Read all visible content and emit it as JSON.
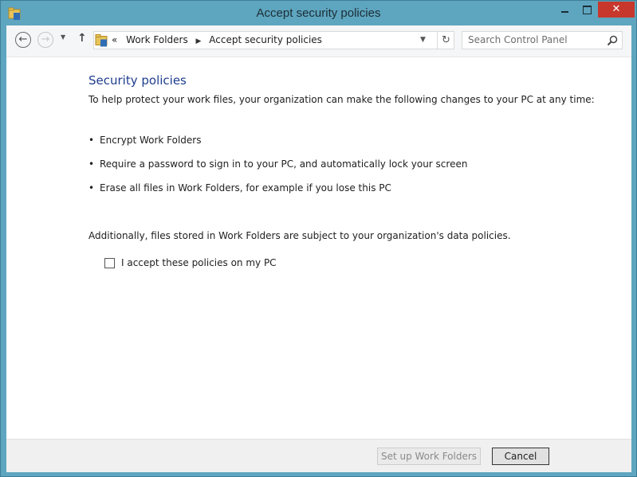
{
  "window": {
    "title": "Accept security policies"
  },
  "address": {
    "prefix": "«",
    "crumbs": [
      "Work Folders",
      "Accept security policies"
    ]
  },
  "search": {
    "placeholder": "Search Control Panel"
  },
  "content": {
    "heading": "Security policies",
    "intro": "To help protect your work files, your organization can make the following changes to your PC at any time:",
    "bullets": [
      "Encrypt Work Folders",
      "Require a password to sign in to your PC, and automatically lock your screen",
      "Erase all files in Work Folders, for example if you lose this PC"
    ],
    "additional": "Additionally, files stored in Work Folders are subject to your organization's data policies.",
    "accept_label": "I accept these policies on my PC",
    "accept_checked": false
  },
  "footer": {
    "setup_label": "Set up Work Folders",
    "cancel_label": "Cancel"
  },
  "colors": {
    "titlebar": "#5ea5bf",
    "close": "#c7372c",
    "heading": "#1e3d8f"
  },
  "icons": [
    "work-folders-icon",
    "back-icon",
    "forward-icon",
    "recent-locations-icon",
    "up-icon",
    "chevron-down-icon",
    "refresh-icon",
    "search-icon"
  ]
}
